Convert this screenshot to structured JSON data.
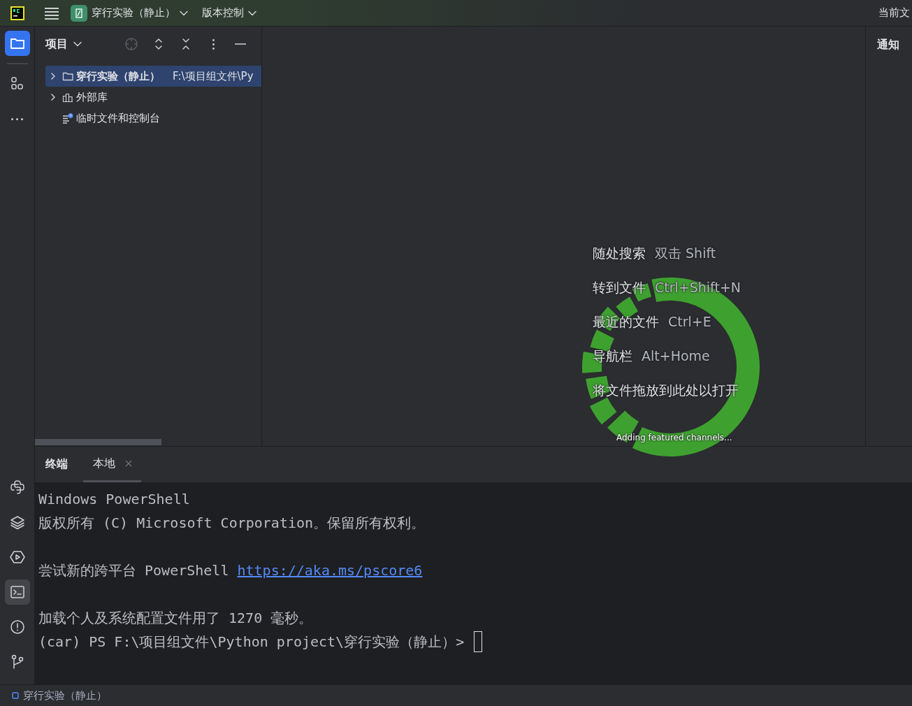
{
  "title_bar": {
    "project": "穿行实验（静止）",
    "vcs": "版本控制",
    "right_text": "当前文"
  },
  "tool_strip": {
    "top": [
      {
        "kind": "folder",
        "selected": true
      },
      {
        "kind": "structure",
        "selected": false
      },
      {
        "kind": "more",
        "selected": false
      }
    ],
    "bottom": [
      {
        "kind": "python",
        "selected": false
      },
      {
        "kind": "layers",
        "selected": false
      },
      {
        "kind": "run",
        "selected": false
      },
      {
        "kind": "terminal",
        "selected": true
      },
      {
        "kind": "problems",
        "selected": false
      },
      {
        "kind": "git",
        "selected": false
      }
    ]
  },
  "project_panel": {
    "title": "项目",
    "tree": [
      {
        "label": "穿行实验（静止）",
        "path": "F:\\项目组文件\\Py",
        "kind": "folder",
        "expanded": false,
        "selected": true
      },
      {
        "label": "外部库",
        "kind": "library",
        "expanded": false,
        "selected": false
      },
      {
        "label": "临时文件和控制台",
        "kind": "scratch",
        "selected": false
      }
    ]
  },
  "hints": [
    {
      "action": "随处搜索",
      "shortcut": "双击 Shift"
    },
    {
      "action": "转到文件",
      "shortcut": "Ctrl+Shift+N"
    },
    {
      "action": "最近的文件",
      "shortcut": "Ctrl+E"
    },
    {
      "action": "导航栏",
      "shortcut": "Alt+Home"
    },
    {
      "action": "将文件拖放到此处以打开"
    }
  ],
  "notifications": {
    "title": "通知"
  },
  "overlay": {
    "text": "Adding featured channels..."
  },
  "terminal": {
    "title": "终端",
    "tabs": [
      {
        "label": "本地",
        "selected": true,
        "closable": true
      }
    ],
    "blocks": [
      {
        "lines": [
          {
            "text": "Windows PowerShell"
          },
          {
            "text": "版权所有 (C) Microsoft Corporation。保留所有权利。"
          }
        ]
      },
      {
        "lines": [
          {
            "text": "尝试新的跨平台 PowerShell ",
            "link": "https://aka.ms/pscore6"
          }
        ]
      },
      {
        "lines": [
          {
            "text": "加载个人及系统配置文件用了 1270 毫秒。"
          },
          {
            "text": "(car) PS F:\\项目组文件\\Python project\\穿行实验（静止）> ",
            "cursor": true
          }
        ]
      }
    ]
  },
  "status_bar": {
    "project": "穿行实验（静止）"
  }
}
